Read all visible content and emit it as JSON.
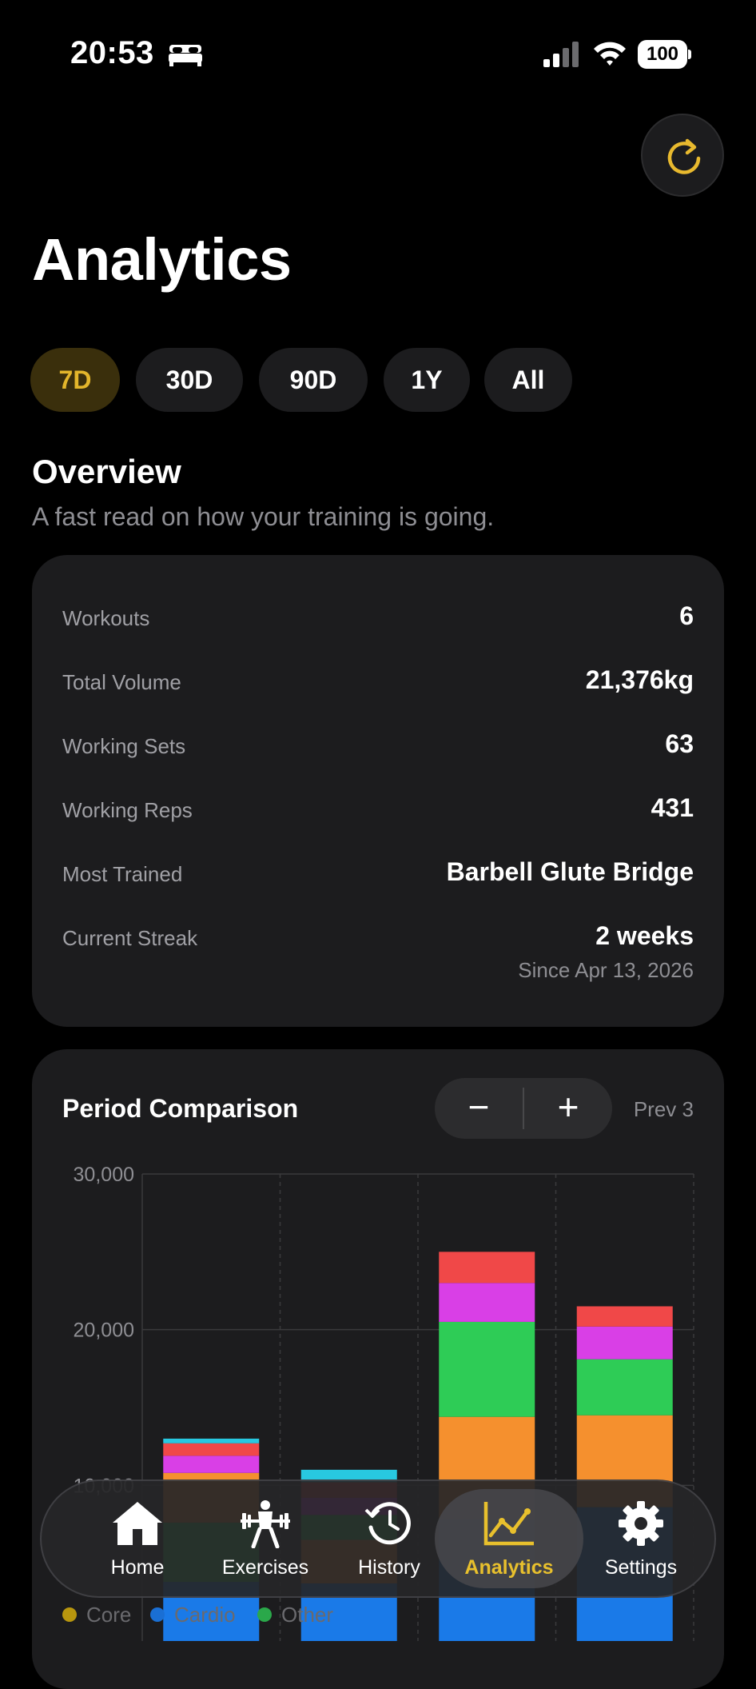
{
  "status_bar": {
    "time": "20:53",
    "battery": "100"
  },
  "header": {
    "title": "Analytics"
  },
  "range_chips": [
    {
      "label": "7D",
      "active": true
    },
    {
      "label": "30D",
      "active": false
    },
    {
      "label": "90D",
      "active": false
    },
    {
      "label": "1Y",
      "active": false
    },
    {
      "label": "All",
      "active": false
    }
  ],
  "overview": {
    "title": "Overview",
    "subtitle": "A fast read on how your training is going.",
    "stats": [
      {
        "label": "Workouts",
        "value": "6"
      },
      {
        "label": "Total Volume",
        "value": "21,376kg"
      },
      {
        "label": "Working Sets",
        "value": "63"
      },
      {
        "label": "Working Reps",
        "value": "431"
      },
      {
        "label": "Most Trained",
        "value": "Barbell Glute Bridge"
      },
      {
        "label": "Current Streak",
        "value": "2 weeks",
        "sub": "Since Apr 13, 2026"
      }
    ]
  },
  "comparison": {
    "title": "Period Comparison",
    "minus": "−",
    "plus": "+",
    "prev_label": "Prev 3"
  },
  "chart_data": {
    "type": "bar",
    "stacked": true,
    "y_ticks": [
      "30,000",
      "20,000",
      "10,000"
    ],
    "ylim": [
      0,
      30000
    ],
    "grid": true,
    "colors": {
      "cardio": "#1a7ae8",
      "green": "#2ecc56",
      "orange": "#f5902e",
      "magenta": "#d93fe6",
      "red": "#f04848",
      "cyan": "#28c8e0"
    },
    "bars": [
      {
        "segments": [
          {
            "color": "cardio",
            "value": 3800
          },
          {
            "color": "green",
            "value": 3800
          },
          {
            "color": "orange",
            "value": 3200
          },
          {
            "color": "magenta",
            "value": 1100
          },
          {
            "color": "red",
            "value": 800
          },
          {
            "color": "cyan",
            "value": 300
          }
        ]
      },
      {
        "segments": [
          {
            "color": "cardio",
            "value": 3700
          },
          {
            "color": "orange",
            "value": 2800
          },
          {
            "color": "green",
            "value": 1600
          },
          {
            "color": "magenta",
            "value": 1100
          },
          {
            "color": "red",
            "value": 1000
          },
          {
            "color": "cyan",
            "value": 800
          }
        ]
      },
      {
        "segments": [
          {
            "color": "cardio",
            "value": 7800
          },
          {
            "color": "orange",
            "value": 6600
          },
          {
            "color": "green",
            "value": 6100
          },
          {
            "color": "magenta",
            "value": 2500
          },
          {
            "color": "red",
            "value": 2000
          }
        ]
      },
      {
        "segments": [
          {
            "color": "cardio",
            "value": 8600
          },
          {
            "color": "orange",
            "value": 5900
          },
          {
            "color": "green",
            "value": 3600
          },
          {
            "color": "magenta",
            "value": 2100
          },
          {
            "color": "red",
            "value": 1300
          }
        ]
      }
    ]
  },
  "legend": [
    {
      "label": "Core",
      "color": "#b8960e"
    },
    {
      "label": "Cardio",
      "color": "#1a6fd4"
    },
    {
      "label": "Other",
      "color": "#2aa84a"
    }
  ],
  "tabs": [
    {
      "label": "Home",
      "icon": "house-icon"
    },
    {
      "label": "Exercises",
      "icon": "weightlifter-icon"
    },
    {
      "label": "History",
      "icon": "history-clock-icon"
    },
    {
      "label": "Analytics",
      "icon": "chart-line-icon",
      "active": true
    },
    {
      "label": "Settings",
      "icon": "gear-icon"
    }
  ]
}
